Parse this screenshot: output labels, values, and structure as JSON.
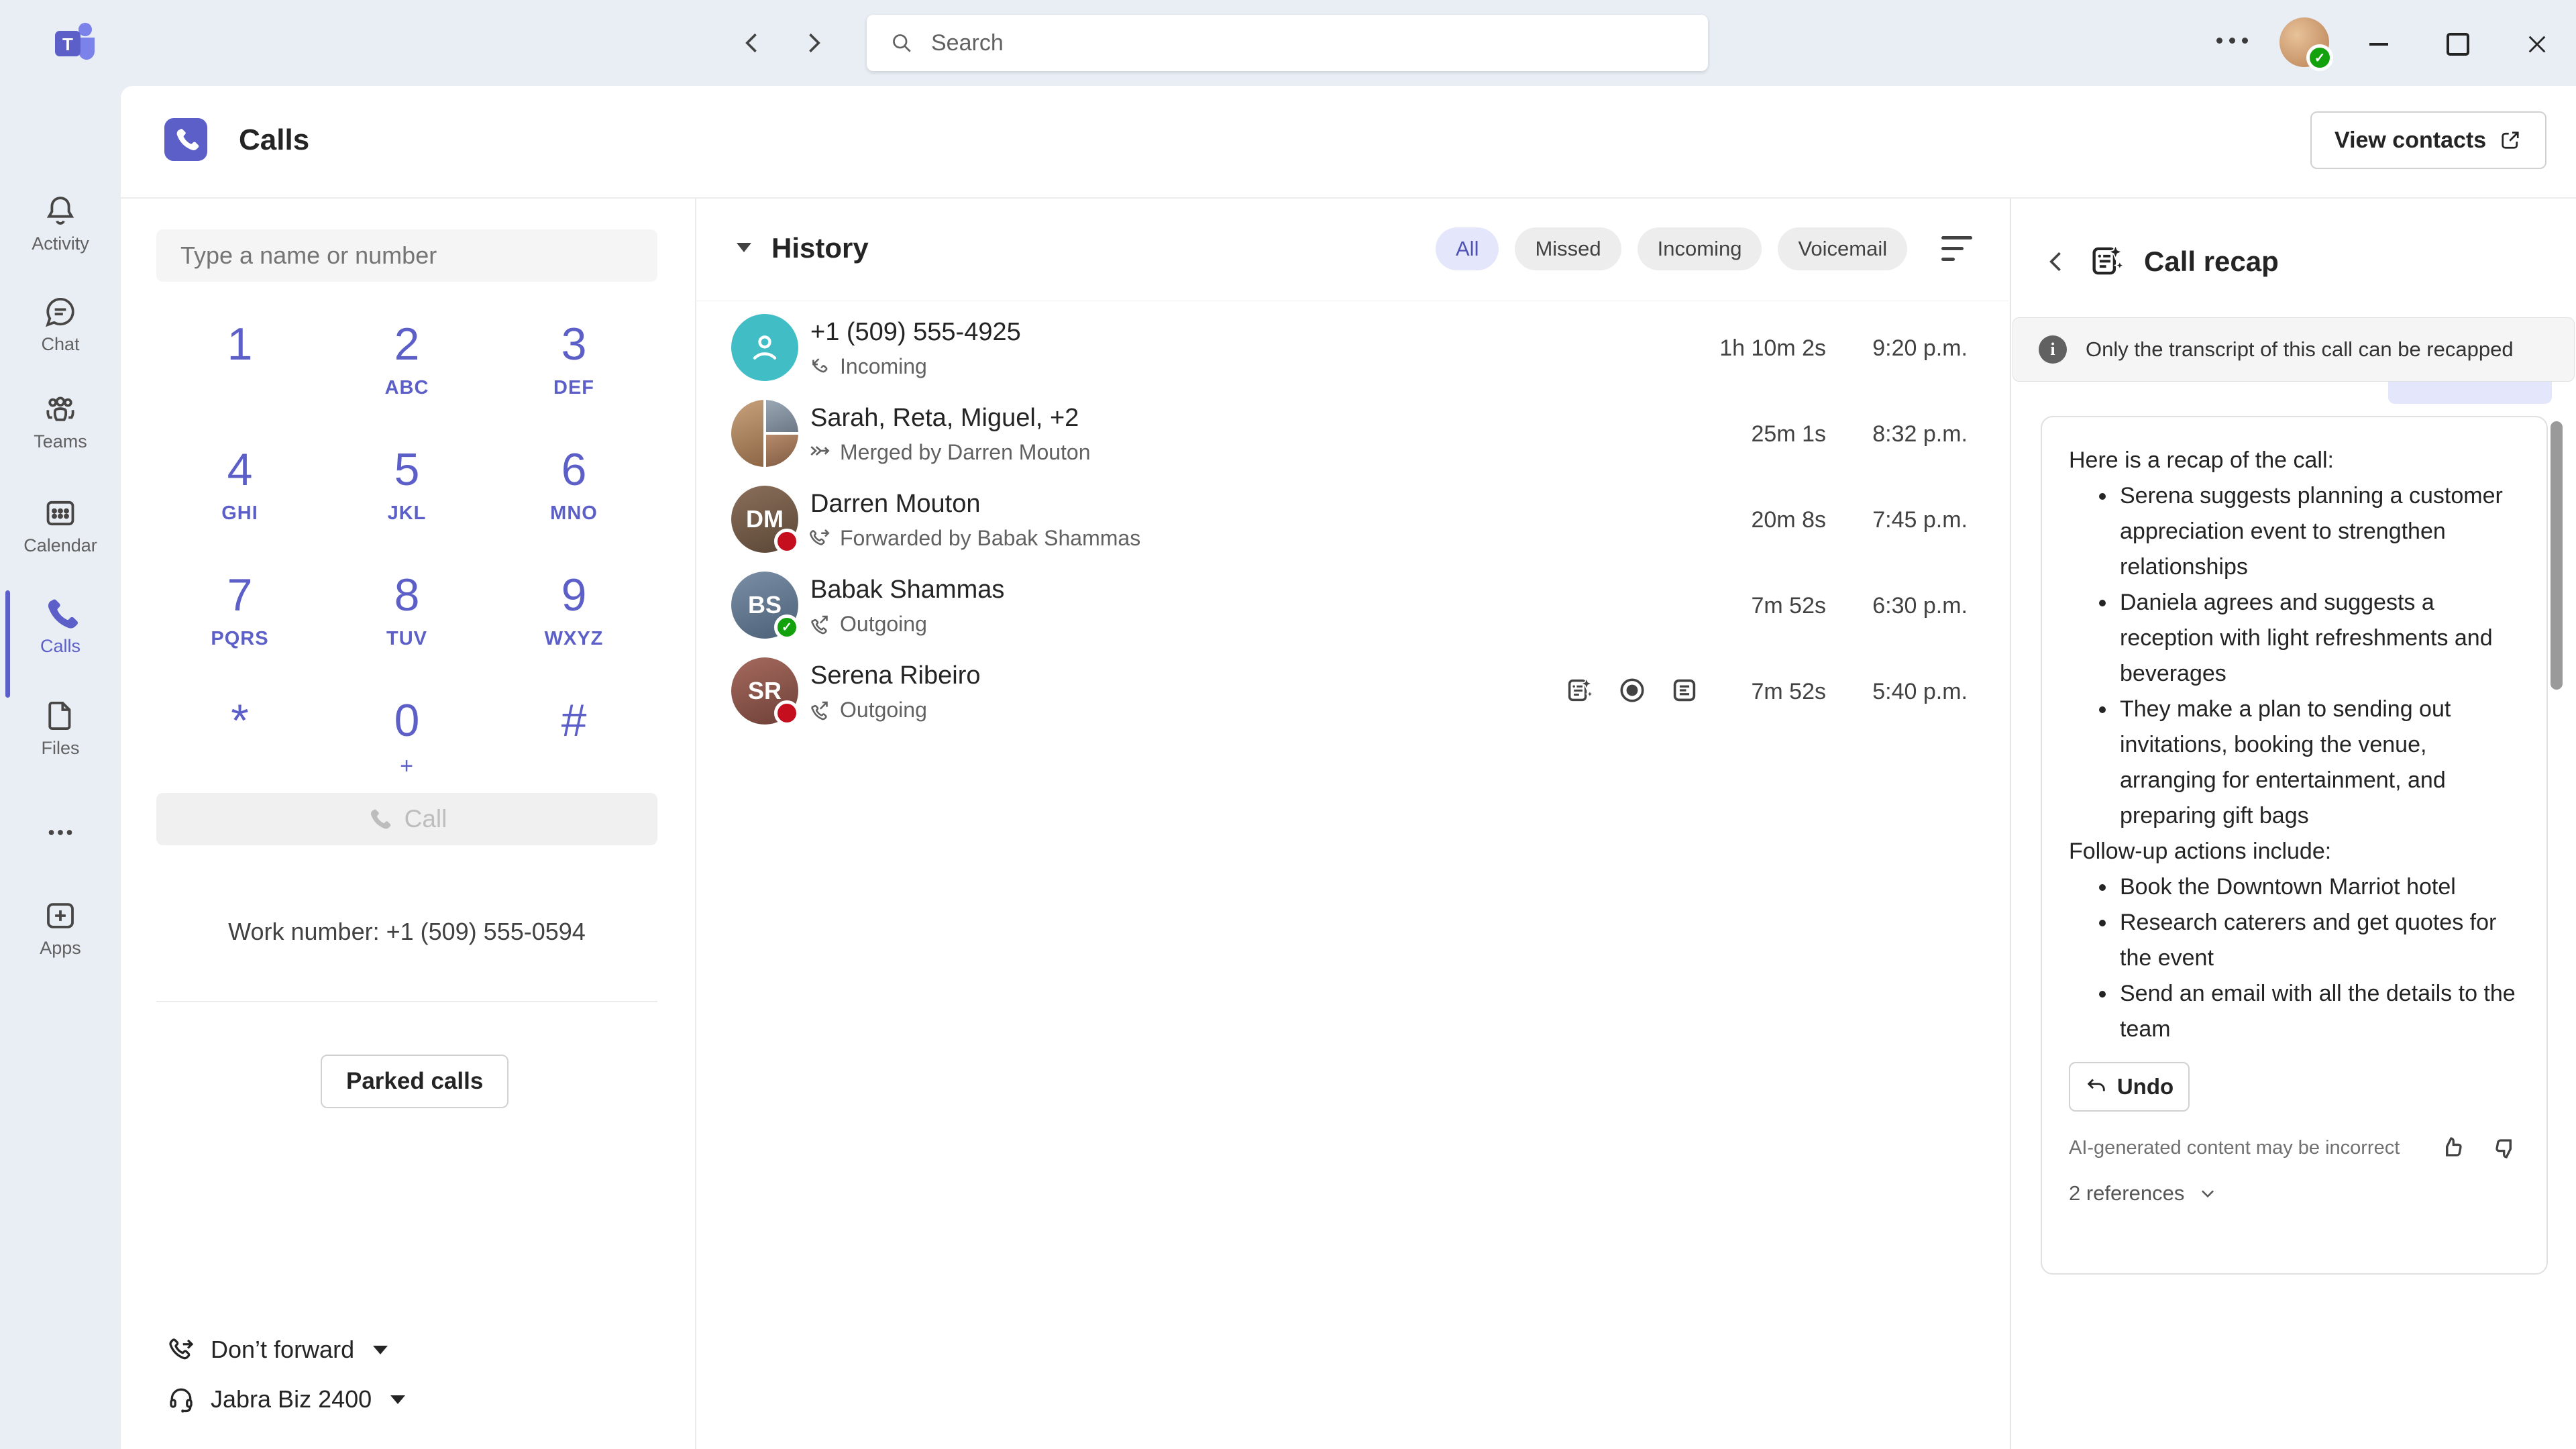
{
  "topbar": {
    "search_placeholder": "Search"
  },
  "sidebar": {
    "items": [
      {
        "label": "Activity"
      },
      {
        "label": "Chat"
      },
      {
        "label": "Teams"
      },
      {
        "label": "Calendar"
      },
      {
        "label": "Calls"
      },
      {
        "label": "Files"
      },
      {
        "label": "Apps"
      }
    ]
  },
  "header": {
    "title": "Calls",
    "view_contacts_label": "View contacts"
  },
  "dialpad": {
    "placeholder": "Type a name or number",
    "keys": [
      {
        "digit": "1",
        "letters": ""
      },
      {
        "digit": "2",
        "letters": "ABC"
      },
      {
        "digit": "3",
        "letters": "DEF"
      },
      {
        "digit": "4",
        "letters": "GHI"
      },
      {
        "digit": "5",
        "letters": "JKL"
      },
      {
        "digit": "6",
        "letters": "MNO"
      },
      {
        "digit": "7",
        "letters": "PQRS"
      },
      {
        "digit": "8",
        "letters": "TUV"
      },
      {
        "digit": "9",
        "letters": "WXYZ"
      },
      {
        "digit": "*",
        "letters": ""
      },
      {
        "digit": "0",
        "letters": "+"
      },
      {
        "digit": "#",
        "letters": ""
      }
    ],
    "call_label": "Call",
    "work_number": "Work number: +1 (509) 555-0594",
    "parked_calls_label": "Parked calls",
    "forward_status": "Don’t forward",
    "audio_device": "Jabra Biz 2400"
  },
  "history": {
    "title": "History",
    "filters": [
      {
        "label": "All"
      },
      {
        "label": "Missed"
      },
      {
        "label": "Incoming"
      },
      {
        "label": "Voicemail"
      }
    ],
    "calls": [
      {
        "name": "+1 (509) 555-4925",
        "detail": "Incoming",
        "duration": "1h 10m 2s",
        "time": "9:20 p.m."
      },
      {
        "name": "Sarah, Reta, Miguel, +2",
        "detail": "Merged by Darren Mouton",
        "duration": "25m 1s",
        "time": "8:32 p.m."
      },
      {
        "name": "Darren Mouton",
        "detail": "Forwarded by Babak Shammas",
        "duration": "20m 8s",
        "time": "7:45 p.m.",
        "initials": "DM"
      },
      {
        "name": "Babak Shammas",
        "detail": "Outgoing",
        "duration": "7m 52s",
        "time": "6:30 p.m.",
        "initials": "BS"
      },
      {
        "name": "Serena Ribeiro",
        "detail": "Outgoing",
        "duration": "7m 52s",
        "time": "5:40 p.m.",
        "initials": "SR"
      }
    ]
  },
  "recap": {
    "title": "Call recap",
    "banner": "Only the transcript of this call can be recapped",
    "intro": "Here is a recap of the call:",
    "bullets": [
      "Serena suggests planning a customer appreciation event to strengthen relationships",
      "Daniela agrees and suggests a reception with light refreshments and beverages",
      "They make a plan to sending out invitations, booking the venue, arranging for entertainment, and preparing gift bags"
    ],
    "followup_heading": "Follow-up actions include:",
    "followup_bullets": [
      "Book the Downtown Marriot hotel",
      "Research caterers and get quotes for the event",
      "Send an email with all the details to the team"
    ],
    "undo_label": "Undo",
    "disclaimer": "AI-generated content may be incorrect",
    "references_label": "2 references"
  },
  "colors": {
    "accent": "#5b5fc7",
    "accent_soft": "#e4e7fb",
    "presence_available": "#13a10e",
    "presence_busy": "#c50f1f",
    "phone_avatar_teal": "#41bdc6"
  }
}
